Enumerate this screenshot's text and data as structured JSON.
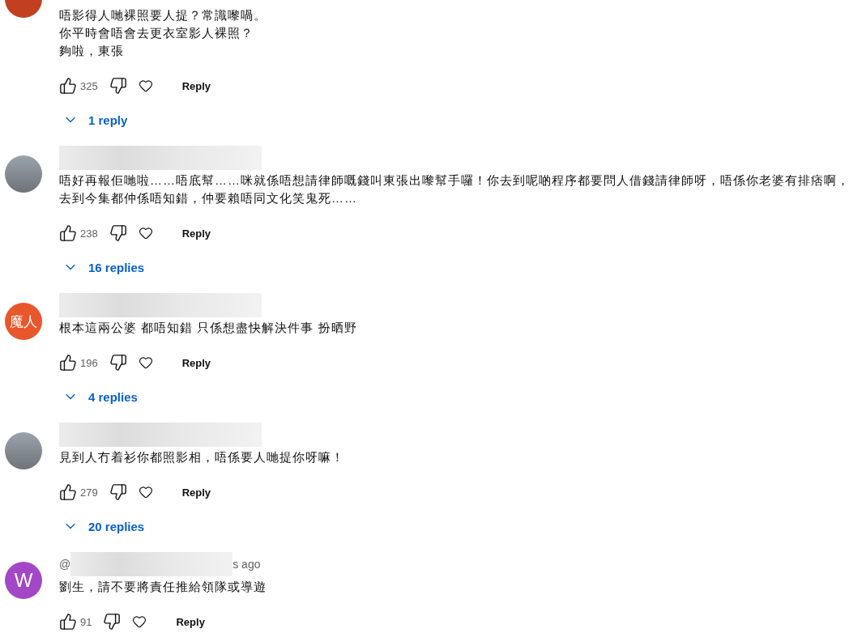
{
  "comments": [
    {
      "avatar": {
        "kind": "letter",
        "color": "#c2401f"
      },
      "lines": [
        "唔影得人哋裸照要人提？常識嚟喎。",
        "你平時會唔會去更衣室影人裸照？",
        "夠啦，東張"
      ],
      "likes": "325",
      "reply": "Reply",
      "replies": "1 reply"
    },
    {
      "avatar": {
        "kind": "photo"
      },
      "header": {
        "redacted": true
      },
      "lines": [
        "唔好再報佢哋啦……唔底幫……咪就係唔想請律師嘅錢叫東張出嚟幫手囉！你去到呢啲程序都要問人借錢請律師呀，唔係你老婆有排痞啊，去到今集都仲係唔知錯，仲要賴唔同文化笑鬼死……"
      ],
      "likes": "238",
      "reply": "Reply",
      "replies": "16 replies"
    },
    {
      "avatar": {
        "kind": "letter",
        "text": "魔人",
        "color": "#e8572b"
      },
      "header": {
        "redacted": true
      },
      "lines": [
        "根本這兩公婆 都唔知錯 只係想盡快解決件事 扮晒野"
      ],
      "likes": "196",
      "reply": "Reply",
      "replies": "4 replies"
    },
    {
      "avatar": {
        "kind": "photo"
      },
      "header": {
        "redacted": true
      },
      "lines": [
        "見到人冇着衫你都照影相，唔係要人哋提你呀嘛！"
      ],
      "likes": "279",
      "reply": "Reply",
      "replies": "20 replies"
    },
    {
      "avatar": {
        "kind": "letter",
        "text": "W",
        "color": "#a347c7"
      },
      "header": {
        "prefix": "@",
        "redacted": true,
        "suffix": "s ago"
      },
      "lines": [
        "劉生，請不要將責任推給領隊或導遊"
      ],
      "likes": "91",
      "reply": "Reply"
    }
  ]
}
